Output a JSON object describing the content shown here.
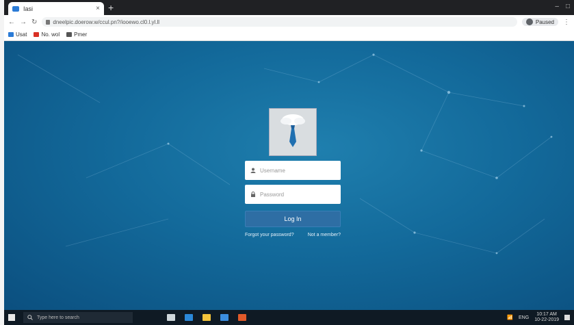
{
  "browser": {
    "tab": {
      "title": "Iasi",
      "close": "×"
    },
    "new_tab": "+",
    "window_controls": [
      "‒",
      "□"
    ],
    "nav": {
      "back": "←",
      "forward": "→",
      "reload": "↻"
    },
    "address": "dneelpic.doerow.w/ccul.pn?/iooewo.cl0.l.yl.ll",
    "profile": "Paused",
    "menu": "⋮",
    "bookmarks": [
      {
        "label": "Usat",
        "color": "#2b7bd6"
      },
      {
        "label": "No. wol",
        "color": "#d93025"
      },
      {
        "label": "Pmer",
        "color": "#555555"
      }
    ]
  },
  "login": {
    "username_placeholder": "Username",
    "password_placeholder": "Password",
    "login_label": "Log In",
    "forgot_label": "Forgot your password?",
    "register_label": "Not a member?",
    "user_icon": "user-icon",
    "lock_icon": "lock-icon"
  },
  "taskbar": {
    "search_placeholder": "Type here to search",
    "tray_text": "ENG",
    "time": "10:17 AM",
    "date": "10-22-2019",
    "apps": [
      {
        "name": "task-view-icon",
        "color": "#cfd8dc"
      },
      {
        "name": "edge-icon",
        "color": "#2b88d8"
      },
      {
        "name": "file-explorer-icon",
        "color": "#f3c33b"
      },
      {
        "name": "mail-icon",
        "color": "#3b8ee0"
      },
      {
        "name": "chrome-icon",
        "color": "#e05a2a"
      }
    ]
  },
  "colors": {
    "page_background": "#136a9b",
    "login_button": "#2e6ea4"
  }
}
